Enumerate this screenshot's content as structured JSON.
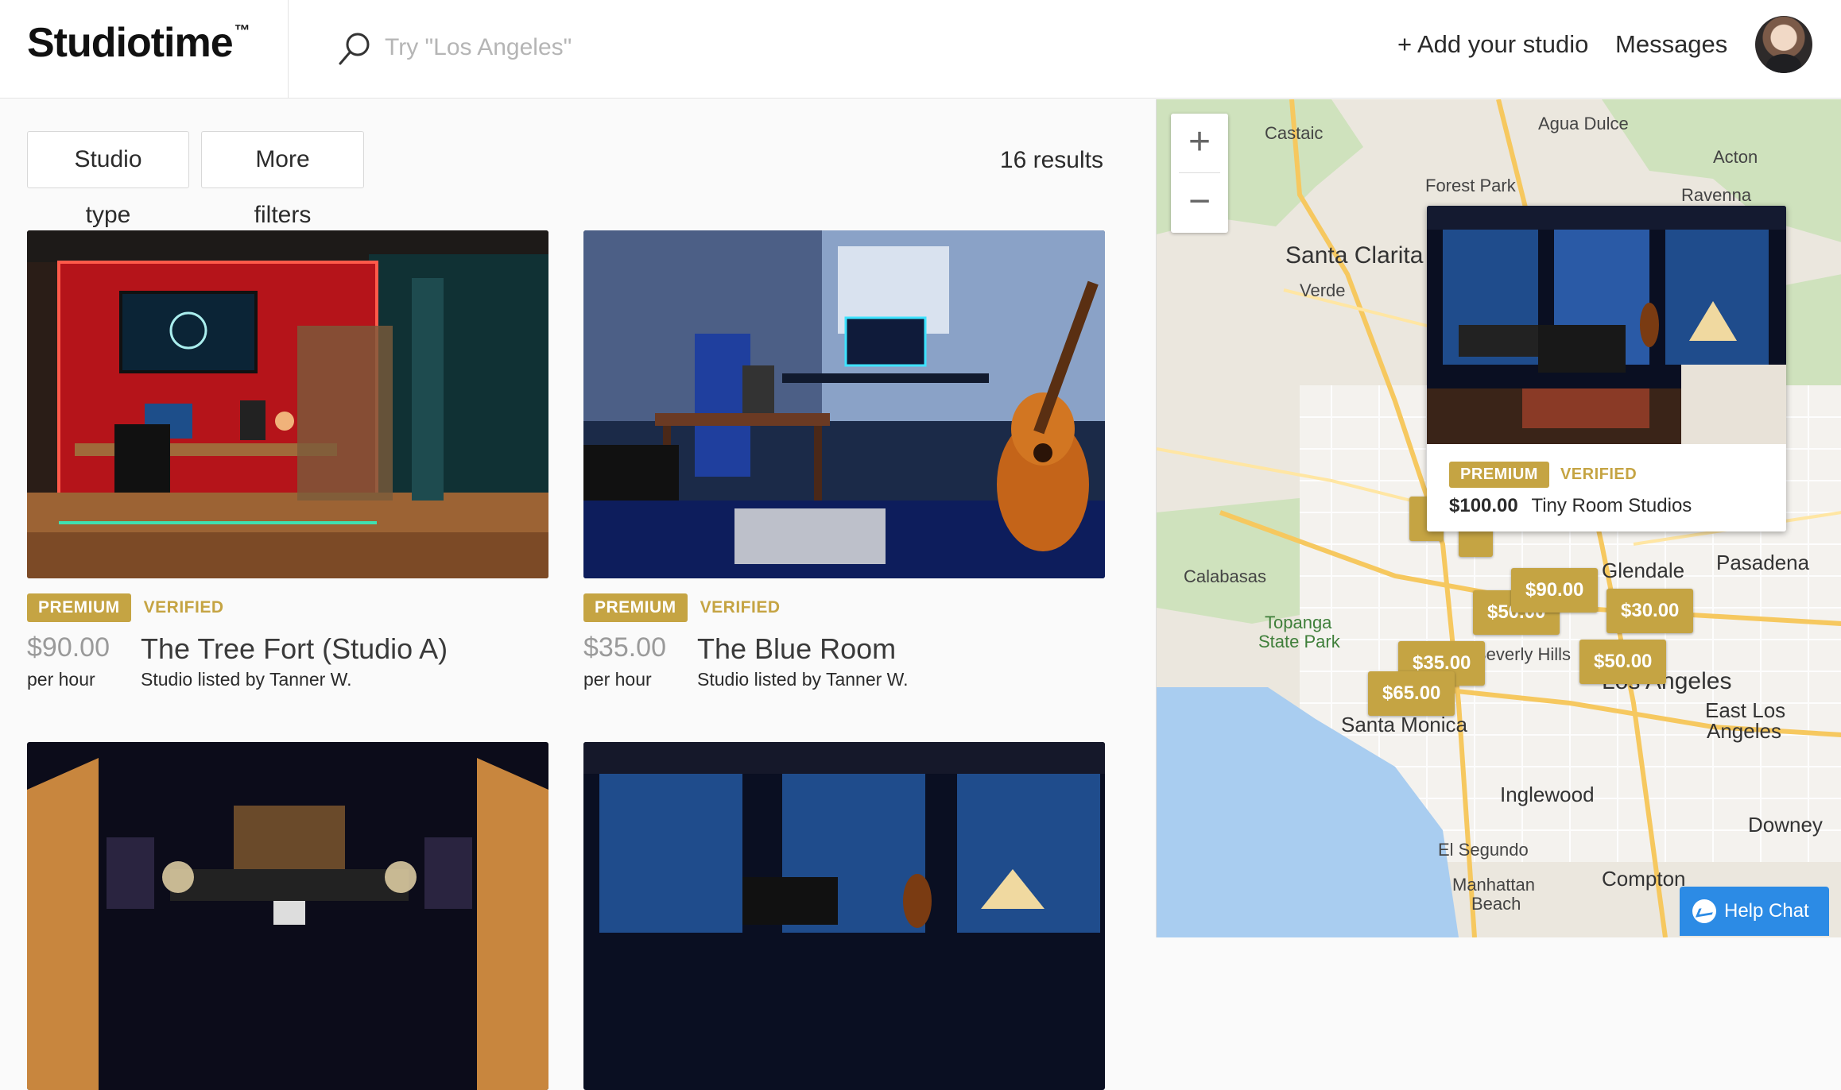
{
  "header": {
    "logo": "Studiotime",
    "logo_tm": "™",
    "search_placeholder": "Try \"Los Angeles\"",
    "add_studio": "+ Add your studio",
    "messages": "Messages"
  },
  "filters": {
    "studio_type": "Studio type",
    "more_filters": "More filters",
    "results": "16 results"
  },
  "listings": [
    {
      "premium": "PREMIUM",
      "verified": "VERIFIED",
      "price": "$90.00",
      "unit": "per hour",
      "title": "The Tree Fort (Studio A)",
      "subtitle": "Studio listed by Tanner W."
    },
    {
      "premium": "PREMIUM",
      "verified": "VERIFIED",
      "price": "$35.00",
      "unit": "per hour",
      "title": "The Blue Room",
      "subtitle": "Studio listed by Tanner W."
    },
    {
      "premium": "",
      "verified": "",
      "price": "",
      "unit": "",
      "title": "",
      "subtitle": ""
    },
    {
      "premium": "",
      "verified": "",
      "price": "",
      "unit": "",
      "title": "",
      "subtitle": ""
    }
  ],
  "map": {
    "zoom_in": "+",
    "zoom_out": "−",
    "places": {
      "castaic": "Castaic",
      "agua_dulce": "Agua Dulce",
      "acton": "Acton",
      "verde": "Verde",
      "forest_park": "Forest Park",
      "ravenna": "Ravenna",
      "santa_clarita": "Santa Clarita",
      "calabasas": "Calabasas",
      "topanga": "Topanga",
      "state_park": "State Park",
      "glendale": "Glendale",
      "pasadena": "Pasadena",
      "los_angeles": "Los Angeles",
      "east_la_1": "East Los",
      "east_la_2": "Angeles",
      "santa_monica": "Santa Monica",
      "inglewood": "Inglewood",
      "downey": "Downey",
      "el_segundo": "El Segundo",
      "manhattan_1": "Manhattan",
      "manhattan_2": "Beach",
      "compton": "Compton",
      "beverly_hills": "Beverly Hills"
    },
    "pins": [
      "$90.00",
      "$50.00",
      "$30.00",
      "$35.00",
      "$50.00",
      "$65.00",
      "$100.00"
    ],
    "popup": {
      "premium": "PREMIUM",
      "verified": "VERIFIED",
      "price": "$100.00",
      "name": "Tiny Room Studios"
    }
  },
  "help_chat": "Help Chat",
  "colors": {
    "gold": "#c5a443",
    "help_blue": "#2c8be5"
  }
}
